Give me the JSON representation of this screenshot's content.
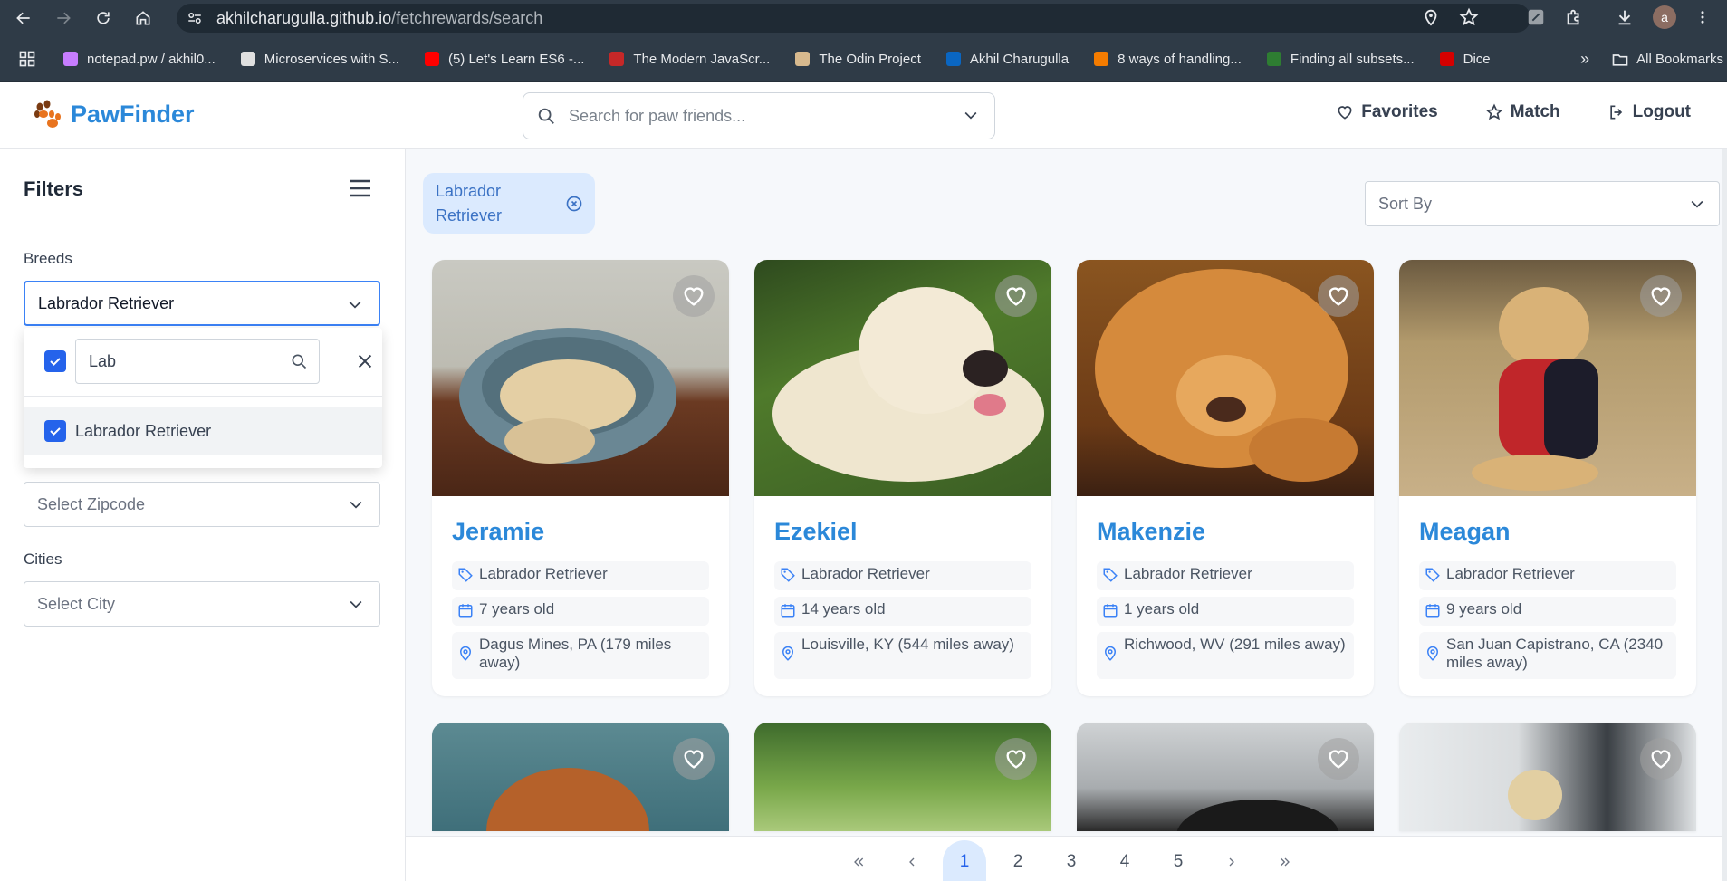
{
  "browser": {
    "url_host": "akhilcharugulla.github.io",
    "url_path": "/fetchrewards/search",
    "profile_initial": "a"
  },
  "bookmarks": [
    {
      "label": "notepad.pw / akhil0...",
      "color": "#c77dff"
    },
    {
      "label": "Microservices with S...",
      "color": "#e0e0e0"
    },
    {
      "label": "(5) Let's Learn ES6 -...",
      "color": "#ff0000"
    },
    {
      "label": "The Modern JavaScr...",
      "color": "#c62828"
    },
    {
      "label": "The Odin Project",
      "color": "#d7b98e"
    },
    {
      "label": "Akhil Charugulla",
      "color": "#0a66c2"
    },
    {
      "label": "8 ways of handling...",
      "color": "#f57c00"
    },
    {
      "label": "Finding all subsets...",
      "color": "#2e7d32"
    },
    {
      "label": "Dice",
      "color": "#d50000"
    }
  ],
  "bookmarks_overflow": "»",
  "bookmarks_folder": "All Bookmarks",
  "header": {
    "brand": "PawFinder",
    "search_placeholder": "Search for paw friends...",
    "favorites": "Favorites",
    "match": "Match",
    "logout": "Logout"
  },
  "sidebar": {
    "title": "Filters",
    "breeds_label": "Breeds",
    "breeds_value": "Labrador Retriever",
    "dropdown_search": "Lab",
    "dropdown_option": "Labrador Retriever",
    "zipcode_placeholder": "Select Zipcode",
    "cities_label": "Cities",
    "city_placeholder": "Select City"
  },
  "filter_chip": {
    "line1": "Labrador",
    "line2": "Retriever"
  },
  "sort": {
    "placeholder": "Sort By"
  },
  "dogs": [
    {
      "name": "Jeramie",
      "breed": "Labrador Retriever",
      "age": "7 years old",
      "location": "Dagus Mines, PA (179 miles away)"
    },
    {
      "name": "Ezekiel",
      "breed": "Labrador Retriever",
      "age": "14 years old",
      "location": "Louisville, KY (544 miles away)"
    },
    {
      "name": "Makenzie",
      "breed": "Labrador Retriever",
      "age": "1 years old",
      "location": "Richwood, WV (291 miles away)"
    },
    {
      "name": "Meagan",
      "breed": "Labrador Retriever",
      "age": "9 years old",
      "location": "San Juan Capistrano, CA (2340 miles away)"
    }
  ],
  "pagination": {
    "pages": [
      "1",
      "2",
      "3",
      "4",
      "5"
    ],
    "current": "1"
  },
  "colors": {
    "accent": "#2b88d9",
    "chip_bg": "#dbeafe",
    "checkbox": "#2563eb"
  }
}
